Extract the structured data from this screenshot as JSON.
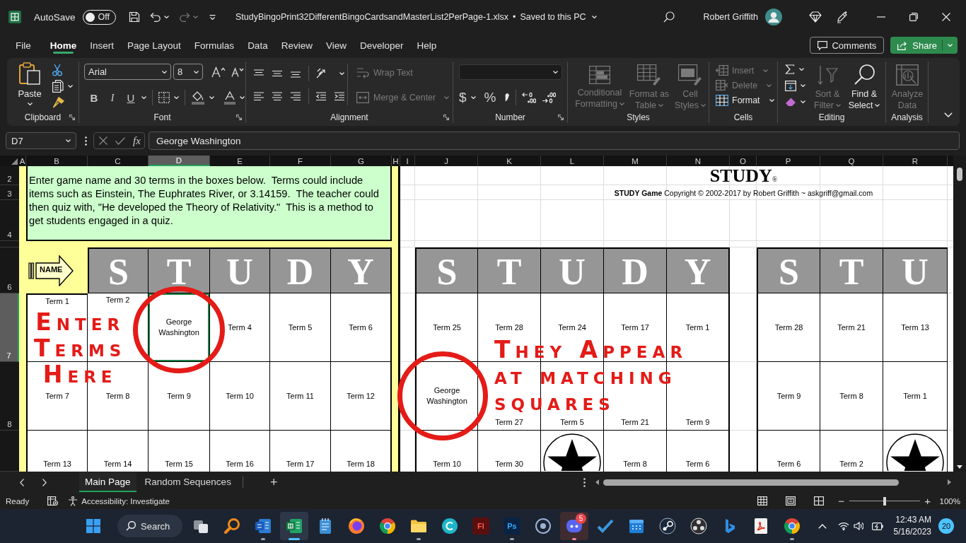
{
  "title_bar": {
    "autosave_label": "AutoSave",
    "autosave": {
      "label": "Off",
      "on": false
    },
    "redo_disabled": true,
    "file_name": "StudyBingoPrint32DifferentBingoCardsandMasterList2PerPage-1.xlsx",
    "separator": "•",
    "save_status": "Saved to this PC",
    "user_name": "Robert Griffith"
  },
  "menu": {
    "tabs": [
      {
        "label": "File",
        "selected": false
      },
      {
        "label": "Home",
        "selected": true
      },
      {
        "label": "Insert",
        "selected": false
      },
      {
        "label": "Page Layout",
        "selected": false
      },
      {
        "label": "Formulas",
        "selected": false
      },
      {
        "label": "Data",
        "selected": false
      },
      {
        "label": "Review",
        "selected": false
      },
      {
        "label": "View",
        "selected": false
      },
      {
        "label": "Developer",
        "selected": false
      },
      {
        "label": "Help",
        "selected": false
      }
    ],
    "comments_button": "Comments",
    "share_button": "Share"
  },
  "ribbon": {
    "groups": [
      {
        "kind": "clipboard",
        "label": "Clipboard",
        "launcher": true,
        "paste": "Paste"
      },
      {
        "kind": "font",
        "label": "Font",
        "launcher": true,
        "font_name": "Arial",
        "font_size": "8",
        "bold": "B",
        "italic": "I",
        "underline": "U"
      },
      {
        "kind": "alignment",
        "label": "Alignment",
        "launcher": true,
        "buttons": [
          {
            "label": "Wrap Text",
            "disabled": true
          },
          {
            "label": "Merge & Center",
            "disabled": true
          }
        ]
      },
      {
        "kind": "number",
        "label": "Number",
        "launcher": true,
        "currency": "$",
        "percent": "%"
      },
      {
        "kind": "styles",
        "label": "Styles",
        "buttons": [
          {
            "label": "Conditional Formatting",
            "disabled": true
          },
          {
            "label": "Format as Table",
            "disabled": true
          },
          {
            "label": "Cell Styles",
            "disabled": true
          }
        ]
      },
      {
        "kind": "cells",
        "label": "Cells",
        "buttons": [
          {
            "label": "Insert",
            "disabled": true
          },
          {
            "label": "Delete",
            "disabled": true
          },
          {
            "label": "Format",
            "disabled": false
          }
        ]
      },
      {
        "kind": "editing",
        "label": "Editing",
        "buttons": [
          {
            "label": "Sort & Filter",
            "disabled": true
          },
          {
            "label": "Find & Select",
            "disabled": false
          }
        ]
      },
      {
        "kind": "analysis",
        "label": "Analysis",
        "buttons": [
          {
            "label": "Analyze Data",
            "disabled": true
          }
        ]
      }
    ]
  },
  "formula_bar": {
    "name_box": "D7",
    "function_label": "fx",
    "formula": "George Washington"
  },
  "sheet": {
    "columns": [
      {
        "label": "A",
        "selected": false
      },
      {
        "label": "B",
        "selected": false
      },
      {
        "label": "C",
        "selected": false
      },
      {
        "label": "D",
        "selected": true
      },
      {
        "label": "E",
        "selected": false
      },
      {
        "label": "F",
        "selected": false
      },
      {
        "label": "G",
        "selected": false
      },
      {
        "label": "H",
        "selected": false
      },
      {
        "label": "I",
        "selected": false
      },
      {
        "label": "J",
        "selected": false
      },
      {
        "label": "K",
        "selected": false
      },
      {
        "label": "L",
        "selected": false
      },
      {
        "label": "M",
        "selected": false
      },
      {
        "label": "N",
        "selected": false
      },
      {
        "label": "O",
        "selected": false
      },
      {
        "label": "P",
        "selected": false
      },
      {
        "label": "Q",
        "selected": false
      },
      {
        "label": "R",
        "selected": false
      }
    ],
    "rows": [
      {
        "label": "2",
        "selected": false
      },
      {
        "label": "3",
        "selected": false
      },
      {
        "label": "4",
        "selected": false
      },
      {
        "selected": false
      },
      {
        "label": "6",
        "selected": false
      },
      {
        "label": "7",
        "selected": true
      },
      {
        "label": "8",
        "selected": false
      },
      {
        "selected": false
      }
    ],
    "instructions": "Enter game name and 30 terms in the boxes below.  Terms could include items such as Einstein, The Euphrates River, or 3.14159.  The teacher could then quiz with, \"He developed the Theory of Relativity.\"  This is a method to get students engaged in a quiz.",
    "name_arrow": "NAME",
    "title": "STUDY",
    "title_mark": "®",
    "copyright": "**STUDY Game** Copyright © 2002-2017 by Robert Griffith ~ askgriff@gmail.com",
    "cards": [
      {
        "header": [
          "S",
          "T",
          "U",
          "D",
          "Y"
        ],
        "rows": [
          [
            {
              "kind": "term",
              "text": "Term 1"
            },
            {
              "kind": "term",
              "text": "Term 2"
            },
            {
              "kind": "term",
              "text": "George Washington"
            },
            {
              "kind": "term",
              "text": "Term 4"
            },
            {
              "kind": "term",
              "text": "Term 5"
            },
            {
              "kind": "term",
              "text": "Term 6"
            }
          ],
          [
            {
              "kind": "term",
              "text": "Term 7"
            },
            {
              "kind": "term",
              "text": "Term 8"
            },
            {
              "kind": "term",
              "text": "Term 9"
            },
            {
              "kind": "term",
              "text": "Term 10"
            },
            {
              "kind": "term",
              "text": "Term 11"
            },
            {
              "kind": "term",
              "text": "Term 12"
            }
          ],
          [
            {
              "kind": "term",
              "text": "Term 13"
            },
            {
              "kind": "term",
              "text": "Term 14"
            },
            {
              "kind": "term",
              "text": "Term 15"
            },
            {
              "kind": "term",
              "text": "Term 16"
            },
            {
              "kind": "term",
              "text": "Term 17"
            },
            {
              "kind": "term",
              "text": "Term 18"
            }
          ]
        ]
      },
      {
        "header": [
          "S",
          "T",
          "U",
          "D",
          "Y"
        ],
        "rows": [
          [
            {
              "kind": "term",
              "text": "Term 25"
            },
            {
              "kind": "term",
              "text": "Term 28"
            },
            {
              "kind": "term",
              "text": "Term 24"
            },
            {
              "kind": "term",
              "text": "Term 17"
            },
            {
              "kind": "term",
              "text": "Term 1"
            }
          ],
          [
            {
              "kind": "term",
              "text": "George Washington"
            },
            {
              "kind": "term",
              "text": "Term 27"
            },
            {
              "kind": "term",
              "text": "Term 5"
            },
            {
              "kind": "term",
              "text": "Term 21"
            },
            {
              "kind": "term",
              "text": "Term 9"
            }
          ],
          [
            {
              "kind": "term",
              "text": "Term 10"
            },
            {
              "kind": "term",
              "text": "Term 30"
            },
            {
              "kind": "free"
            },
            {
              "kind": "term",
              "text": "Term 8"
            },
            {
              "kind": "term",
              "text": "Term 6"
            }
          ]
        ]
      },
      {
        "header": [
          "S",
          "T",
          "U"
        ],
        "rows": [
          [
            {
              "kind": "term",
              "text": "Term 28"
            },
            {
              "kind": "term",
              "text": "Term 21"
            },
            {
              "kind": "term",
              "text": "Term 13"
            }
          ],
          [
            {
              "kind": "term",
              "text": "Term 9"
            },
            {
              "kind": "term",
              "text": "Term 8"
            },
            {
              "kind": "term",
              "text": "Term 1"
            }
          ],
          [
            {
              "kind": "term",
              "text": "Term 6"
            },
            {
              "kind": "term",
              "text": "Term 2"
            },
            {
              "kind": "free"
            }
          ]
        ]
      }
    ],
    "callouts": [
      {
        "text": "Enter Terms Here"
      },
      {
        "text": "They Appear at matching squares"
      }
    ]
  },
  "sheet_tabs": {
    "tabs": [
      {
        "label": "Main Page",
        "selected": true
      },
      {
        "label": "Random Sequences",
        "selected": false
      }
    ],
    "new_sheet": "+"
  },
  "status_bar": {
    "status": "Ready",
    "accessibility": "Accessibility: Investigate",
    "zoom_out": "−",
    "zoom_in": "+",
    "zoom": {
      "level": 0.5,
      "reading": "100%"
    }
  },
  "taskbar": {
    "search": "Search",
    "apps": [
      {
        "kind": "magnifier",
        "running": false,
        "active": false,
        "attention": false
      },
      {
        "kind": "word",
        "running": true,
        "active": false,
        "attention": false
      },
      {
        "kind": "excel",
        "running": true,
        "active": true,
        "attention": false
      },
      {
        "kind": "notepad",
        "running": false,
        "active": false,
        "attention": false
      },
      {
        "kind": "firefox",
        "running": false,
        "active": false,
        "attention": false
      },
      {
        "kind": "chrome",
        "running": false,
        "active": false,
        "attention": false
      },
      {
        "kind": "explorer",
        "running": true,
        "active": false,
        "attention": false
      },
      {
        "kind": "canva",
        "running": false,
        "active": false,
        "attention": false
      },
      {
        "kind": "flash",
        "label": "Fl",
        "running": false,
        "active": false,
        "attention": false
      },
      {
        "kind": "photoshop",
        "label": "Ps",
        "running": true,
        "active": false,
        "attention": false
      },
      {
        "kind": "recorder",
        "running": false,
        "active": false,
        "attention": false
      },
      {
        "kind": "discord",
        "badge": "5",
        "running": true,
        "active": false,
        "attention": true
      },
      {
        "kind": "todo",
        "running": false,
        "active": false,
        "attention": false
      },
      {
        "kind": "calendar",
        "running": false,
        "active": false,
        "attention": false
      },
      {
        "kind": "steam",
        "running": false,
        "active": false,
        "attention": false
      },
      {
        "kind": "obs",
        "running": false,
        "active": false,
        "attention": false
      },
      {
        "kind": "bing",
        "running": false,
        "active": false,
        "attention": false
      },
      {
        "kind": "acrobat",
        "running": false,
        "active": false,
        "attention": false
      },
      {
        "kind": "chrome",
        "running": true,
        "active": false,
        "attention": false
      }
    ],
    "clock": {
      "time": "12:43 AM",
      "date": "5/16/2023"
    },
    "notifications": "20"
  }
}
